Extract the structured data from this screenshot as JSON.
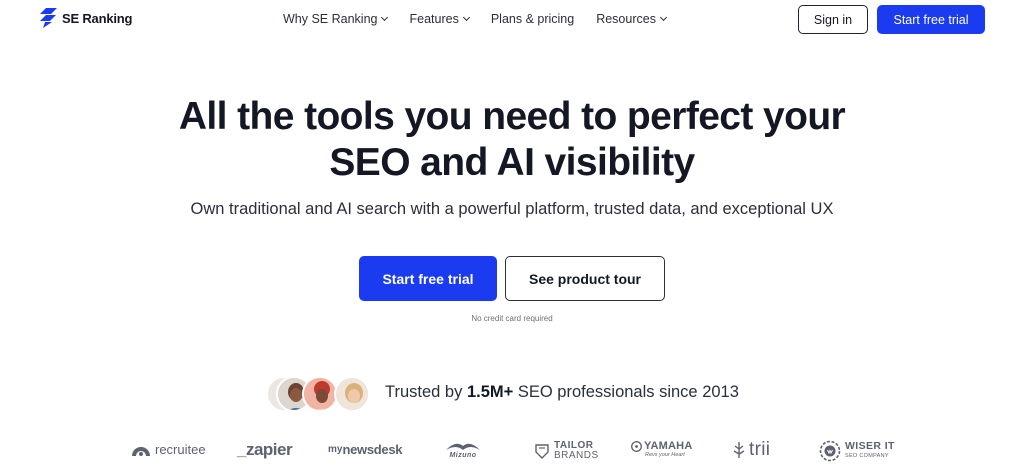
{
  "nav": {
    "logo_text": "SE Ranking",
    "menu": [
      {
        "label": "Why SE Ranking",
        "has_dropdown": true
      },
      {
        "label": "Features",
        "has_dropdown": true
      },
      {
        "label": "Plans & pricing",
        "has_dropdown": false
      },
      {
        "label": "Resources",
        "has_dropdown": true
      }
    ],
    "signin_label": "Sign in",
    "trial_label": "Start free trial"
  },
  "hero": {
    "title_line1": "All the tools you need to perfect your",
    "title_line2": "SEO and AI visibility",
    "subtitle": "Own traditional and AI search with a powerful platform, trusted data, and exceptional UX",
    "cta_primary": "Start free trial",
    "cta_secondary": "See product tour",
    "note": "No credit card required"
  },
  "trust": {
    "prefix": "Trusted by",
    "highlight": "1.5M+",
    "suffix": "SEO professionals since 2013"
  },
  "brands": {
    "recruitee": "recruitee",
    "zapier": "_zapier",
    "newsdesk_my": "my",
    "newsdesk": "newsdesk",
    "mizuno": "Mizuno",
    "tailor_1": "TAILOR",
    "tailor_2": "BRANDS",
    "yamaha": "YAMAHA",
    "yamaha_tag": "Revs your Heart",
    "trii": "trii",
    "wiser_1": "WISER IT",
    "wiser_2": "SEO COMPANY"
  },
  "colors": {
    "accent": "#1a3bf0",
    "text": "#141824",
    "muted": "#5d6270"
  }
}
